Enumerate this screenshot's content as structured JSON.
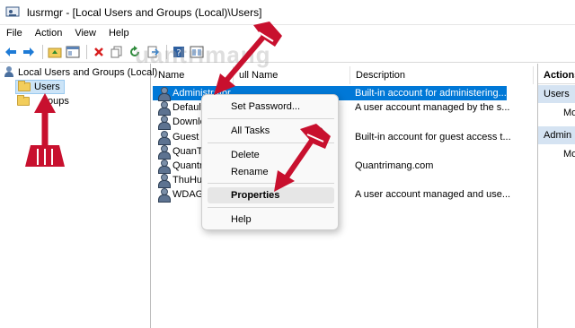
{
  "window": {
    "title": "lusrmgr - [Local Users and Groups (Local)\\Users]"
  },
  "menu": [
    "File",
    "Action",
    "View",
    "Help"
  ],
  "toolbar": {
    "icons": [
      "back-arrow-icon",
      "forward-arrow-icon",
      "up-folder-icon",
      "show-hide-tree-icon",
      "delete-icon",
      "copy-icon",
      "refresh-icon",
      "export-icon",
      "help-icon",
      "properties-icon"
    ]
  },
  "tree": {
    "root": "Local Users and Groups (Local)",
    "users": "Users",
    "groups": "Groups",
    "groups_visible": "oups"
  },
  "list": {
    "headers": {
      "name": "Name",
      "full_name": "Full Name",
      "full_name_visible": "ull Name",
      "description": "Description"
    },
    "rows": [
      {
        "name": "Administrator",
        "description": "Built-in account for administering...",
        "selected": true
      },
      {
        "name": "Default",
        "description": "A user account managed by the s..."
      },
      {
        "name": "Downlo",
        "description": ""
      },
      {
        "name": "Guest",
        "description": "Built-in account for guest access t..."
      },
      {
        "name": "QuanTr",
        "description": ""
      },
      {
        "name": "Quantr",
        "description": "Quantrimang.com"
      },
      {
        "name": "ThuHu",
        "description": ""
      },
      {
        "name": "WDAGU",
        "description": "A user account managed and use..."
      }
    ]
  },
  "actions_pane": {
    "header": "Actions",
    "section1": "Users",
    "item1": "Mo",
    "section2": "Admin",
    "item2": "Mo"
  },
  "context_menu": {
    "items": {
      "set_password": "Set Password...",
      "all_tasks": "All Tasks",
      "delete": "Delete",
      "rename": "Rename",
      "properties": "Properties",
      "help": "Help"
    },
    "highlighted": "Properties"
  },
  "watermark": "uantrimang",
  "colors": {
    "selection": "#0078d7",
    "arrow_red": "#c8102e",
    "tree_selection": "#cce4f7",
    "actions_section": "#d5e3f2"
  }
}
